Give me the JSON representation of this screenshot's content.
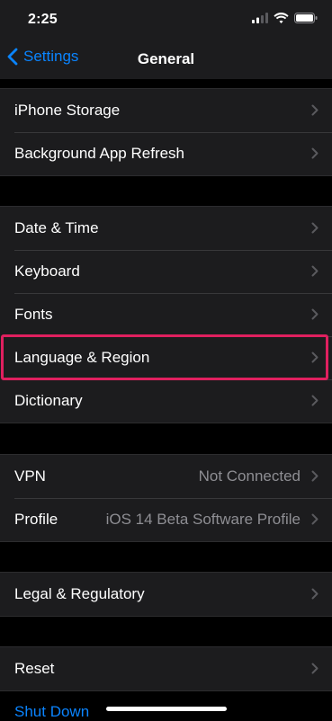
{
  "status": {
    "time": "2:25"
  },
  "nav": {
    "back_label": "Settings",
    "title": "General"
  },
  "group1": [
    {
      "label": "iPhone Storage",
      "value": ""
    },
    {
      "label": "Background App Refresh",
      "value": ""
    }
  ],
  "group2": [
    {
      "label": "Date & Time",
      "value": ""
    },
    {
      "label": "Keyboard",
      "value": ""
    },
    {
      "label": "Fonts",
      "value": ""
    },
    {
      "label": "Language & Region",
      "value": ""
    },
    {
      "label": "Dictionary",
      "value": ""
    }
  ],
  "group3": [
    {
      "label": "VPN",
      "value": "Not Connected"
    },
    {
      "label": "Profile",
      "value": "iOS 14 Beta Software Profile"
    }
  ],
  "group4": [
    {
      "label": "Legal & Regulatory",
      "value": ""
    }
  ],
  "group5": [
    {
      "label": "Reset",
      "value": ""
    }
  ],
  "shutdown_label": "Shut Down",
  "colors": {
    "accent": "#0a84ff",
    "highlight": "#e0205f",
    "background": "#000000",
    "cell": "#1c1c1e",
    "secondary_text": "#8e8e93"
  }
}
